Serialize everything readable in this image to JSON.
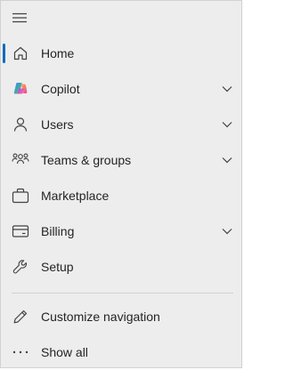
{
  "nav": {
    "menu_icon": "hamburger-icon",
    "accent_color": "#0f6cbd",
    "items": [
      {
        "label": "Home",
        "icon": "home-icon",
        "active": true,
        "expandable": false
      },
      {
        "label": "Copilot",
        "icon": "copilot-icon",
        "active": false,
        "expandable": true
      },
      {
        "label": "Users",
        "icon": "person-icon",
        "active": false,
        "expandable": true
      },
      {
        "label": "Teams & groups",
        "icon": "people-group-icon",
        "active": false,
        "expandable": true
      },
      {
        "label": "Marketplace",
        "icon": "shopping-bag-icon",
        "active": false,
        "expandable": false
      },
      {
        "label": "Billing",
        "icon": "credit-card-icon",
        "active": false,
        "expandable": true
      },
      {
        "label": "Setup",
        "icon": "wrench-icon",
        "active": false,
        "expandable": false
      }
    ],
    "footer_items": [
      {
        "label": "Customize navigation",
        "icon": "pencil-icon"
      },
      {
        "label": "Show all",
        "icon": "more-icon"
      }
    ]
  }
}
